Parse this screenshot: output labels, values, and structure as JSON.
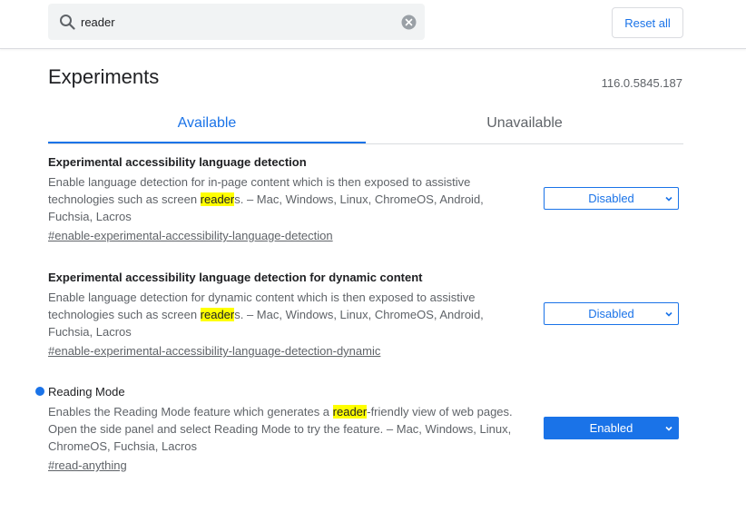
{
  "search": {
    "value": "reader",
    "placeholder": "Search flags"
  },
  "header": {
    "reset_label": "Reset all",
    "title": "Experiments",
    "version": "116.0.5845.187"
  },
  "tabs": [
    {
      "label": "Available",
      "selected": true
    },
    {
      "label": "Unavailable",
      "selected": false
    }
  ],
  "experiments": [
    {
      "title": "Experimental accessibility language detection",
      "desc_before": "Enable language detection for in-page content which is then exposed to assistive technologies such as screen ",
      "desc_highlight": "reader",
      "desc_after": "s. – Mac, Windows, Linux, ChromeOS, Android, Fuchsia, Lacros",
      "link": "#enable-experimental-accessibility-language-detection",
      "state": "Disabled",
      "modified": false
    },
    {
      "title": "Experimental accessibility language detection for dynamic content",
      "desc_before": "Enable language detection for dynamic content which is then exposed to assistive technologies such as screen ",
      "desc_highlight": "reader",
      "desc_after": "s. – Mac, Windows, Linux, ChromeOS, Android, Fuchsia, Lacros",
      "link": "#enable-experimental-accessibility-language-detection-dynamic",
      "state": "Disabled",
      "modified": false
    },
    {
      "title": "Reading Mode",
      "desc_before": "Enables the Reading Mode feature which generates a ",
      "desc_highlight": "reader",
      "desc_after": "-friendly view of web pages. Open the side panel and select Reading Mode to try the feature. – Mac, Windows, Linux, ChromeOS, Fuchsia, Lacros",
      "link": "#read-anything",
      "state": "Enabled",
      "modified": true
    }
  ],
  "colors": {
    "accent": "#1a73e8",
    "highlight": "#ffff00",
    "text_secondary": "#5f6368"
  },
  "icons": {
    "search": "search-icon",
    "clear": "clear-icon",
    "dropdown": "chevron-down-icon",
    "modified": "modified-dot"
  }
}
